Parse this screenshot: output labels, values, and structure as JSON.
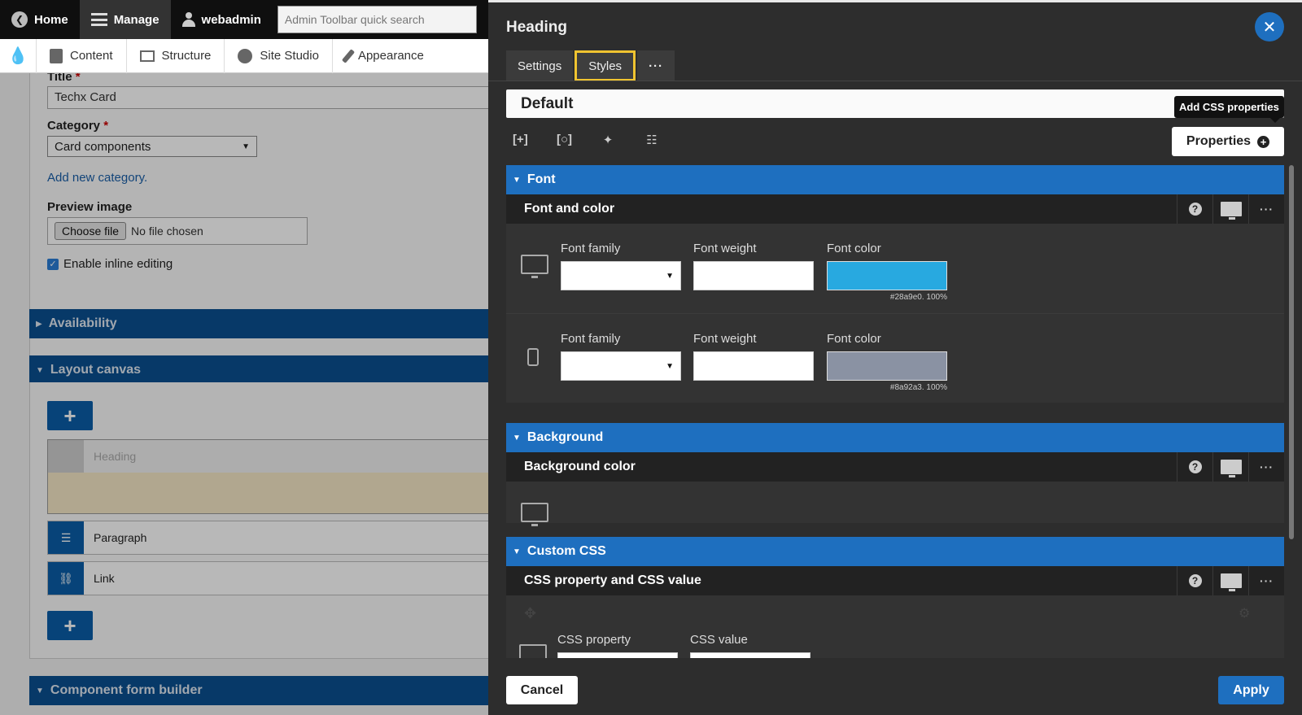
{
  "toolbar": {
    "home_label": "Home",
    "manage_label": "Manage",
    "user_label": "webadmin",
    "search_placeholder": "Admin Toolbar quick search"
  },
  "subnav": {
    "items": [
      {
        "label": "Content"
      },
      {
        "label": "Structure"
      },
      {
        "label": "Site Studio"
      },
      {
        "label": "Appearance"
      }
    ]
  },
  "form": {
    "title_label": "Title",
    "title_required": "*",
    "title_value": "Techx Card",
    "category_label": "Category",
    "category_required": "*",
    "category_value": "Card components",
    "add_category_link": "Add new category.",
    "preview_label": "Preview image",
    "choose_file_label": "Choose file",
    "no_file_text": "No file chosen",
    "inline_editing_label": "Enable inline editing",
    "availability_label": "Availability",
    "layout_canvas_label": "Layout canvas",
    "canvas_items": [
      "Heading",
      "Paragraph",
      "Link"
    ],
    "component_form_builder_label": "Component form builder"
  },
  "modal": {
    "title": "Heading",
    "tabs": {
      "settings": "Settings",
      "styles": "Styles",
      "more": "···"
    },
    "default_label": "Default",
    "tooltip": "Add CSS properties",
    "properties_button": "Properties",
    "sections": {
      "font": {
        "label": "Font",
        "group_label": "Font and color",
        "desktop": {
          "font_family_label": "Font family",
          "font_weight_label": "Font weight",
          "font_color_label": "Font color",
          "color_value": "#28a9e0. 100%",
          "color_hex": "#28a9e0"
        },
        "mobile": {
          "font_family_label": "Font family",
          "font_weight_label": "Font weight",
          "font_color_label": "Font color",
          "color_value": "#8a92a3. 100%",
          "color_hex": "#8a92a3"
        }
      },
      "background": {
        "label": "Background",
        "group_label": "Background color"
      },
      "custom_css": {
        "label": "Custom CSS",
        "group_label": "CSS property and CSS value",
        "css_property_label": "CSS property",
        "css_value_label": "CSS value"
      }
    },
    "cancel_button": "Cancel",
    "apply_button": "Apply"
  },
  "colors": {
    "accent": "#1e6fbf",
    "toolbar_bg": "#0f0f0f",
    "modal_bg": "#2d2d2d",
    "tab_highlight": "#f0c430"
  }
}
